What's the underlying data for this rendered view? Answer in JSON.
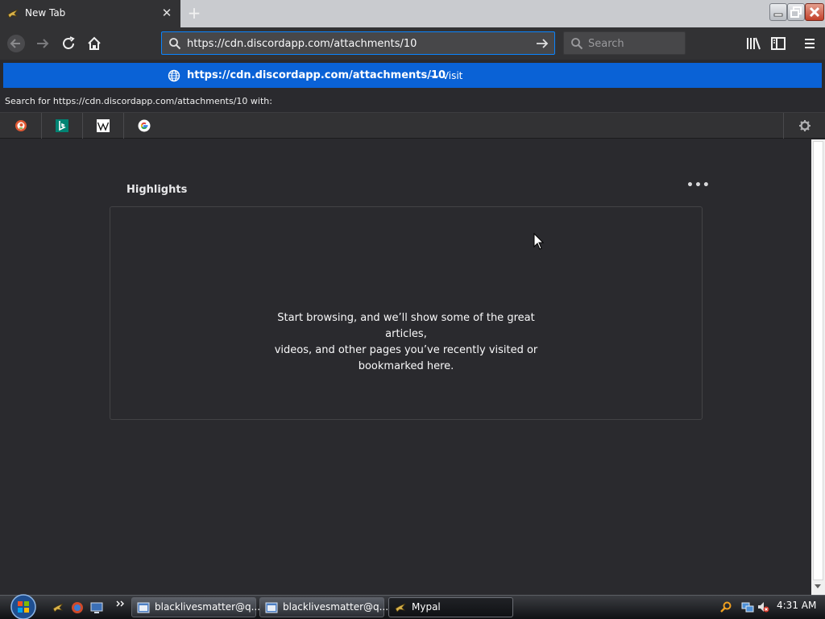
{
  "tab": {
    "title": "New Tab",
    "close": "✕"
  },
  "newtab": {
    "label": "+"
  },
  "urlbar": {
    "value": "https://cdn.discordapp.com/attachments/10"
  },
  "searchbar": {
    "placeholder": "Search"
  },
  "autocomplete": {
    "url": "https://cdn.discordapp.com/attachments/10",
    "action": "— Visit",
    "search_with": "Search for https://cdn.discordapp.com/attachments/10 with:",
    "engines": [
      "duckduckgo-icon",
      "bing-icon",
      "wikipedia-icon",
      "google-icon"
    ]
  },
  "content": {
    "highlights_title": "Highlights",
    "more": "•••",
    "empty_line1": "Start browsing, and we’ll show some of the great articles,",
    "empty_line2": "videos, and other pages you’ve recently visited or",
    "empty_line3": "bookmarked here."
  },
  "taskbar": {
    "tasks": [
      {
        "label": "blacklivesmatter@q..."
      },
      {
        "label": "blacklivesmatter@q..."
      },
      {
        "label": "Mypal"
      }
    ],
    "clock": "4:31 AM"
  },
  "colors": {
    "accent": "#0a84ff",
    "highlight_row": "#0a62d6",
    "background": "#2a2a2e",
    "toolbar": "#323234"
  }
}
